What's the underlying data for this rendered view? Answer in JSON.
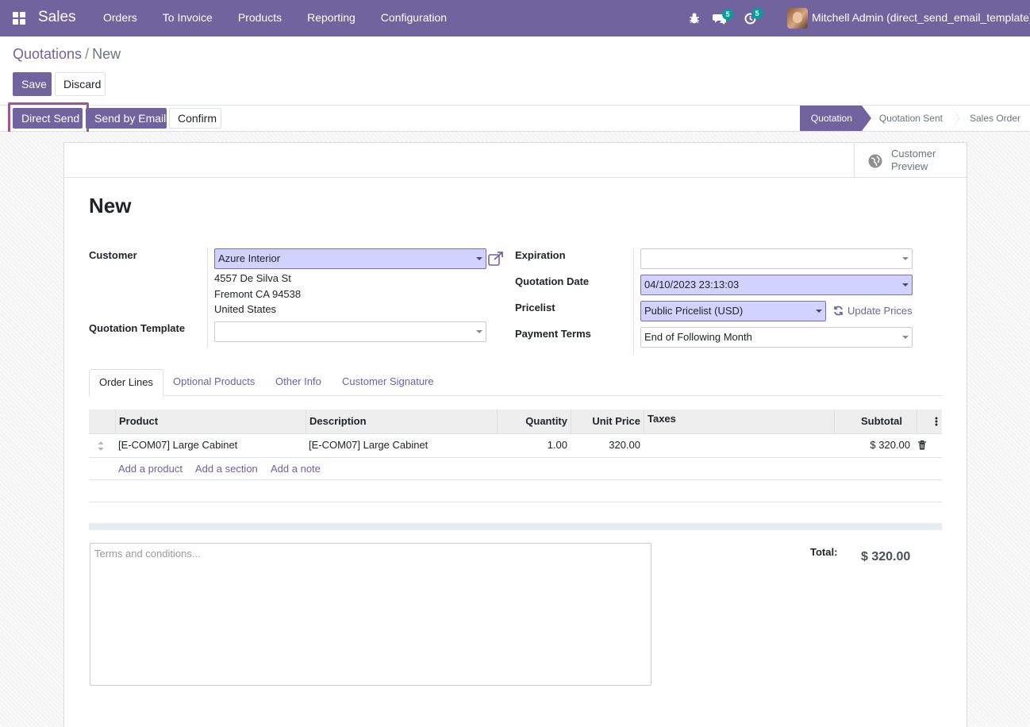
{
  "navbar": {
    "app_name": "Sales",
    "menu": [
      "Orders",
      "To Invoice",
      "Products",
      "Reporting",
      "Configuration"
    ],
    "messages_count": "5",
    "activities_count": "5",
    "user_name": "Mitchell Admin (direct_send_email_template)"
  },
  "breadcrumb": {
    "parent": "Quotations",
    "separator": "/",
    "current": "New"
  },
  "control": {
    "save_label": "Save",
    "discard_label": "Discard"
  },
  "header": {
    "direct_send_label": "Direct Send",
    "send_email_label": "Send by Email",
    "confirm_label": "Confirm",
    "stages": [
      "Quotation",
      "Quotation Sent",
      "Sales Order"
    ],
    "active_stage": "Quotation"
  },
  "button_box": {
    "preview_line1": "Customer",
    "preview_line2": "Preview"
  },
  "record": {
    "title": "New"
  },
  "form": {
    "customer_label": "Customer",
    "customer_value": "Azure Interior",
    "address": [
      "4557 De Silva St",
      "Fremont CA 94538",
      "United States"
    ],
    "template_label": "Quotation Template",
    "template_value": "",
    "expiration_label": "Expiration",
    "expiration_value": "",
    "quotation_date_label": "Quotation Date",
    "quotation_date_value": "04/10/2023 23:13:03",
    "pricelist_label": "Pricelist",
    "pricelist_value": "Public Pricelist (USD)",
    "update_prices_label": "Update Prices",
    "payment_terms_label": "Payment Terms",
    "payment_terms_value": "End of Following Month"
  },
  "tabs": [
    "Order Lines",
    "Optional Products",
    "Other Info",
    "Customer Signature"
  ],
  "table": {
    "columns": [
      "Product",
      "Description",
      "Quantity",
      "Unit Price",
      "Taxes",
      "Subtotal"
    ],
    "rows": [
      {
        "product": "[E-COM07] Large Cabinet",
        "description": "[E-COM07] Large Cabinet",
        "quantity": "1.00",
        "unit_price": "320.00",
        "taxes": "",
        "subtotal": "$ 320.00"
      }
    ],
    "add_product": "Add a product",
    "add_section": "Add a section",
    "add_note": "Add a note"
  },
  "terms_placeholder": "Terms and conditions...",
  "totals": {
    "total_label": "Total:",
    "total_value": "$ 320.00"
  },
  "colors": {
    "brand": "#71639e",
    "required_field": "#d2d2ff",
    "badge": "#00a09d",
    "highlight": "#a4548e"
  }
}
